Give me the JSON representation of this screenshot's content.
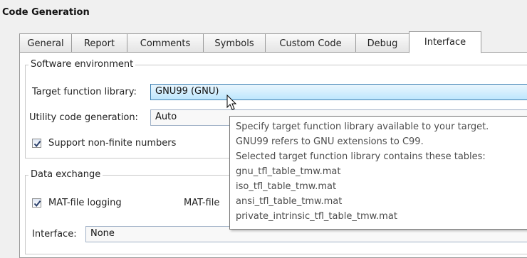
{
  "window": {
    "title": "Code Generation"
  },
  "tabs": [
    {
      "label": "General"
    },
    {
      "label": "Report"
    },
    {
      "label": "Comments"
    },
    {
      "label": "Symbols"
    },
    {
      "label": "Custom Code"
    },
    {
      "label": "Debug"
    },
    {
      "label": "Interface",
      "active": true
    }
  ],
  "software_environment": {
    "legend": "Software environment",
    "target_library_label": "Target function library:",
    "target_library_value": "GNU99 (GNU)",
    "utility_label": "Utility code generation:",
    "utility_value": "Auto",
    "nonfinite_label": "Support non-finite numbers",
    "nonfinite_checked": true
  },
  "data_exchange": {
    "legend": "Data exchange",
    "matfile_label": "MAT-file logging",
    "matfile_checked": true,
    "matfile_variable_label": "MAT-file",
    "interface_label": "Interface:",
    "interface_value": "None"
  },
  "tooltip": {
    "lines": [
      "Specify target function library available to your target.",
      "GNU99 refers to GNU extensions to C99.",
      "Selected target function library contains these tables:",
      "gnu_tfl_table_tmw.mat",
      "iso_tfl_table_tmw.mat",
      "ansi_tfl_table_tmw.mat",
      "private_intrinsic_tfl_table_tmw.mat"
    ]
  },
  "colors": {
    "background": "#f0f0f0",
    "combo_focus": "#bde6fd",
    "tooltip_text": "#4c4c4c"
  }
}
